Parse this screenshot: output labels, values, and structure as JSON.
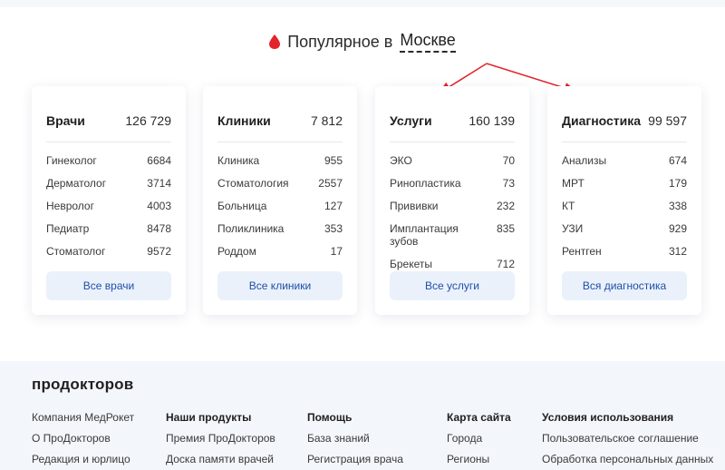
{
  "heading": {
    "prefix": "Популярное в",
    "city": "Москве"
  },
  "cards": [
    {
      "title": "Врачи",
      "count": "126 729",
      "rows": [
        {
          "name": "Гинеколог",
          "num": "6684"
        },
        {
          "name": "Дерматолог",
          "num": "3714"
        },
        {
          "name": "Невролог",
          "num": "4003"
        },
        {
          "name": "Педиатр",
          "num": "8478"
        },
        {
          "name": "Стоматолог",
          "num": "9572"
        }
      ],
      "button": "Все врачи"
    },
    {
      "title": "Клиники",
      "count": "7 812",
      "rows": [
        {
          "name": "Клиника",
          "num": "955"
        },
        {
          "name": "Стоматология",
          "num": "2557"
        },
        {
          "name": "Больница",
          "num": "127"
        },
        {
          "name": "Поликлиника",
          "num": "353"
        },
        {
          "name": "Роддом",
          "num": "17"
        }
      ],
      "button": "Все клиники"
    },
    {
      "title": "Услуги",
      "count": "160 139",
      "rows": [
        {
          "name": "ЭКО",
          "num": "70"
        },
        {
          "name": "Ринопластика",
          "num": "73"
        },
        {
          "name": "Прививки",
          "num": "232"
        },
        {
          "name": "Имплантация зубов",
          "num": "835"
        },
        {
          "name": "Брекеты",
          "num": "712"
        }
      ],
      "button": "Все услуги"
    },
    {
      "title": "Диагностика",
      "count": "99 597",
      "rows": [
        {
          "name": "Анализы",
          "num": "674"
        },
        {
          "name": "МРТ",
          "num": "179"
        },
        {
          "name": "КТ",
          "num": "338"
        },
        {
          "name": "УЗИ",
          "num": "929"
        },
        {
          "name": "Рентген",
          "num": "312"
        }
      ],
      "button": "Вся диагностика"
    }
  ],
  "footer": {
    "logo": "продокторов",
    "col1": {
      "links": [
        "Компания МедРокет",
        "О ПроДокторов",
        "Редакция и юрлицо"
      ]
    },
    "col2": {
      "title": "Наши продукты",
      "links": [
        "Премия ПроДокторов",
        "Доска памяти врачей"
      ]
    },
    "col3": {
      "title": "Помощь",
      "links": [
        "База знаний",
        "Регистрация врача"
      ]
    },
    "col4": {
      "title": "Карта сайта",
      "links": [
        "Города",
        "Регионы"
      ]
    },
    "col5": {
      "title": "Условия использования",
      "links": [
        "Пользовательское соглашение",
        "Обработка персональных данных"
      ]
    }
  },
  "colors": {
    "accent_red": "#e3242b",
    "button_bg": "#ebf1fb",
    "button_text": "#1e4fa8",
    "footer_bg": "#f3f6fb"
  },
  "icons": {
    "heading": "drop-icon"
  }
}
